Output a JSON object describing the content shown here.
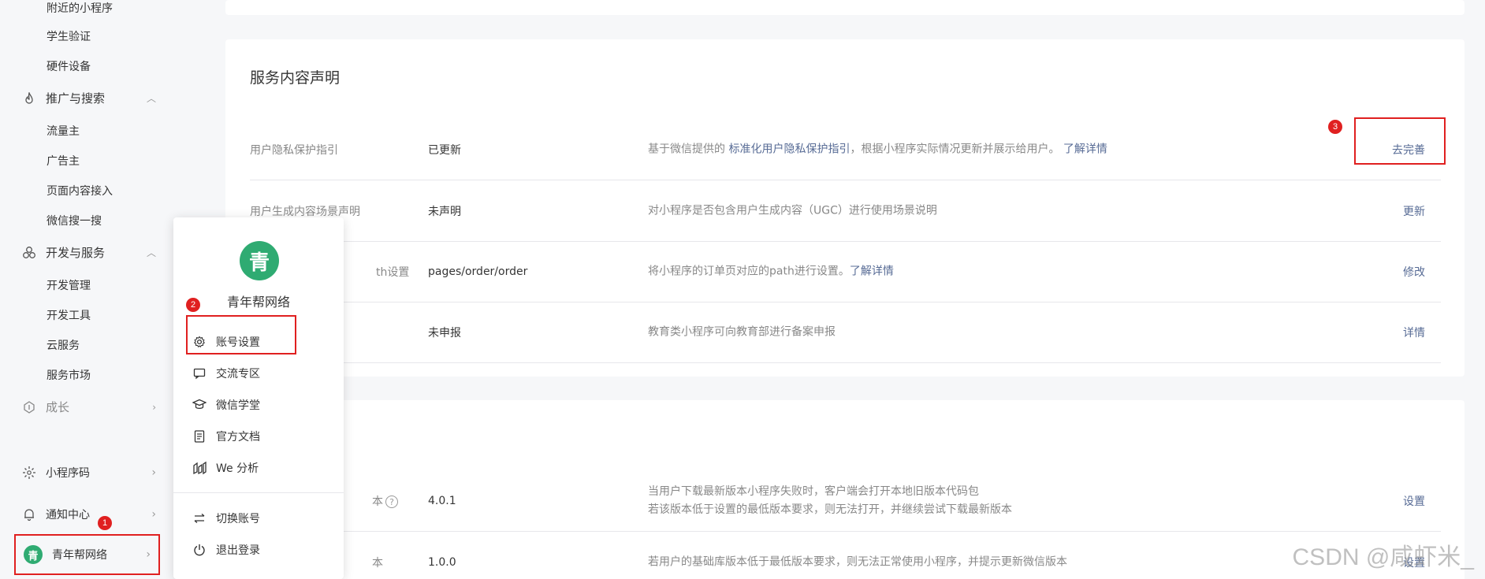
{
  "sidebar": {
    "top_subitems": [
      "附近的小程序",
      "学生验证",
      "硬件设备"
    ],
    "group_promote": {
      "label": "推广与搜索",
      "items": [
        "流量主",
        "广告主",
        "页面内容接入",
        "微信搜一搜"
      ]
    },
    "group_dev": {
      "label": "开发与服务",
      "items": [
        "开发管理",
        "开发工具",
        "云服务",
        "服务市场"
      ]
    },
    "group_grow": {
      "label": "成长"
    },
    "qrcode": "小程序码",
    "notify": "通知中心",
    "account": "青年帮网络",
    "avatar_glyph": "青"
  },
  "badges": {
    "b1": "1",
    "b2": "2",
    "b3": "3"
  },
  "card1": {
    "title": "服务内容声明",
    "rows": [
      {
        "label": "用户隐私保护指引",
        "status": "已更新",
        "desc_prefix": "基于微信提供的 ",
        "desc_link": "标准化用户隐私保护指引",
        "desc_suffix": "，根据小程序实际情况更新并展示给用户。",
        "desc_more": "了解详情",
        "action": "去完善"
      },
      {
        "label": "用户生成内容场景声明",
        "status": "未声明",
        "desc": "对小程序是否包含用户生成内容（UGC）进行使用场景说明",
        "action": "更新"
      },
      {
        "label_tail": "th设置",
        "status": "pages/order/order",
        "desc_prefix": "将小程序的订单页对应的path进行设置。",
        "desc_more": "了解详情",
        "action": "修改"
      },
      {
        "status": "未申报",
        "desc": "教育类小程序可向教育部进行备案申报",
        "action": "详情"
      }
    ]
  },
  "card2": {
    "rows": [
      {
        "label_tail": "本",
        "status": "4.0.1",
        "desc_line1": "当用户下载最新版本小程序失败时，客户端会打开本地旧版本代码包",
        "desc_line2": "若该版本低于设置的最低版本要求，则无法打开，并继续尝试下载最新版本",
        "action": "设置"
      },
      {
        "label_tail": "本",
        "status": "1.0.0",
        "desc": "若用户的基础库版本低于最低版本要求，则无法正常使用小程序，并提示更新微信版本",
        "action": "设置"
      }
    ]
  },
  "popover": {
    "avatar_glyph": "青",
    "name": "青年帮网络",
    "items": [
      "账号设置",
      "交流专区",
      "微信学堂",
      "官方文档",
      "We 分析"
    ],
    "items2": [
      "切换账号",
      "退出登录"
    ]
  },
  "watermark": "CSDN @咸虾米_",
  "colors": {
    "accent_link": "#576b95",
    "highlight": "#e02020",
    "brand_green": "#2fab72"
  }
}
